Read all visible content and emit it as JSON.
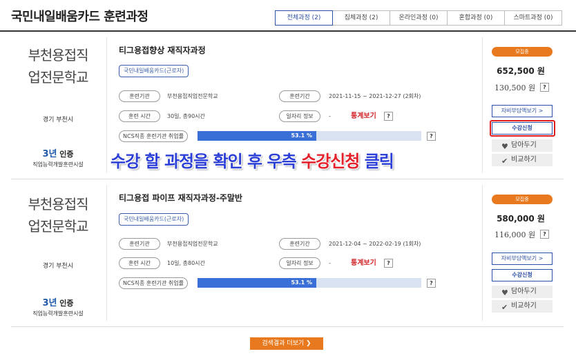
{
  "page": {
    "title": "국민내일배움카드 훈련과정",
    "tabs": [
      {
        "label": "전체과정 (2)",
        "active": true
      },
      {
        "label": "집체과정 (2)",
        "active": false
      },
      {
        "label": "온라인과정 (0)",
        "active": false
      },
      {
        "label": "혼합과정 (0)",
        "active": false
      },
      {
        "label": "스마트과정 (0)",
        "active": false
      }
    ]
  },
  "courses": [
    {
      "school_line1": "부천용접직",
      "school_line2": "업전문학교",
      "region": "경기 부천시",
      "cert_num": "3년",
      "cert_label": "인증",
      "cert_sub": "직업능력개발훈련시설",
      "title": "티그용접향상 재직자과정",
      "badge": "국민내일배움카드(근로자)",
      "labels": {
        "institution": "훈련기관",
        "period": "훈련기간",
        "hours": "훈련 시간",
        "job_info": "일자리 정보",
        "ncs": "NCS직종 훈련기관 취업률"
      },
      "institution": "부천용접직업전문학교",
      "period": "2021-11-15 ~ 2021-12-27 (2회차)",
      "hours": "30일, 총90시간",
      "job_info": "-",
      "stat_link": "통계보기",
      "employment_rate": "53.1 %",
      "employment_rate_value": 53.1,
      "status": "모집중",
      "price": "652,500 원",
      "self_pay": "130,500 원",
      "btn_self_pay": "자비부담액보기 >",
      "btn_apply": "수강신청",
      "btn_wish": "담아두기",
      "btn_compare": "비교하기",
      "q": "?"
    },
    {
      "school_line1": "부천용접직",
      "school_line2": "업전문학교",
      "region": "경기 부천시",
      "cert_num": "3년",
      "cert_label": "인증",
      "cert_sub": "직업능력개발훈련시설",
      "title": "티그용접 파이프 재직자과정-주말반",
      "badge": "국민내일배움카드(근로자)",
      "labels": {
        "institution": "훈련기관",
        "period": "훈련기간",
        "hours": "훈련 시간",
        "job_info": "일자리 정보",
        "ncs": "NCS직종 훈련기관 취업률"
      },
      "institution": "부천용접직업전문학교",
      "period": "2021-12-04 ~ 2022-02-19 (1회차)",
      "hours": "10일, 총80시간",
      "job_info": "-",
      "stat_link": "통계보기",
      "employment_rate": "53.1 %",
      "employment_rate_value": 53.1,
      "status": "모집중",
      "price": "580,000 원",
      "self_pay": "116,000 원",
      "btn_self_pay": "자비부담액보기 >",
      "btn_apply": "수강신청",
      "btn_wish": "담아두기",
      "btn_compare": "비교하기",
      "q": "?"
    }
  ],
  "instruction": {
    "part1": "수강 할 과정을 확인 후 우측 ",
    "part2": "수강신청",
    "part3": " 클릭"
  },
  "more_button": "검색결과 더보기 ❯",
  "colors": {
    "accent_blue": "#2b4ea6",
    "orange": "#e8791e",
    "red": "#e01b1b",
    "bar": "#3b6fd8"
  }
}
